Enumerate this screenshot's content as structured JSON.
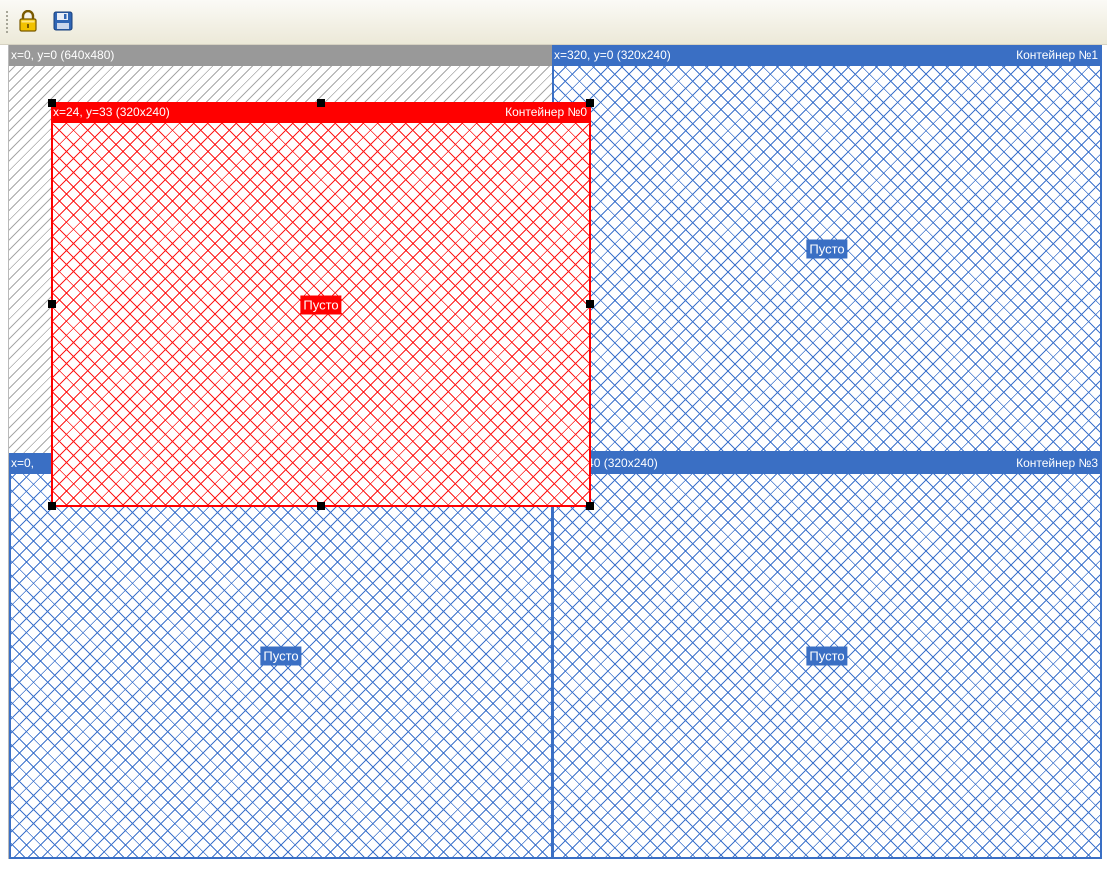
{
  "toolbar": {
    "lock_icon": "lock-icon",
    "save_icon": "floppy-disk-icon"
  },
  "canvas": {
    "label": "x=0, y=0 (640x480)",
    "pattern_color": "#a8a8a8"
  },
  "containers": [
    {
      "name": "Контейнер №0",
      "info": "x=24, y=33 (320x240)",
      "content": "Пусто",
      "selected": true,
      "color": "#ff0000"
    },
    {
      "name": "Контейнер №1",
      "info": "x=320, y=0 (320x240)",
      "content": "Пусто",
      "selected": false,
      "color": "#3a6fc4"
    },
    {
      "name": "",
      "info": "x=0,",
      "content": "Пусто",
      "selected": false,
      "color": "#3a6fc4"
    },
    {
      "name": "Контейнер №3",
      "info": "0, y=240 (320x240)",
      "content": "Пусто",
      "selected": false,
      "color": "#3a6fc4"
    }
  ]
}
